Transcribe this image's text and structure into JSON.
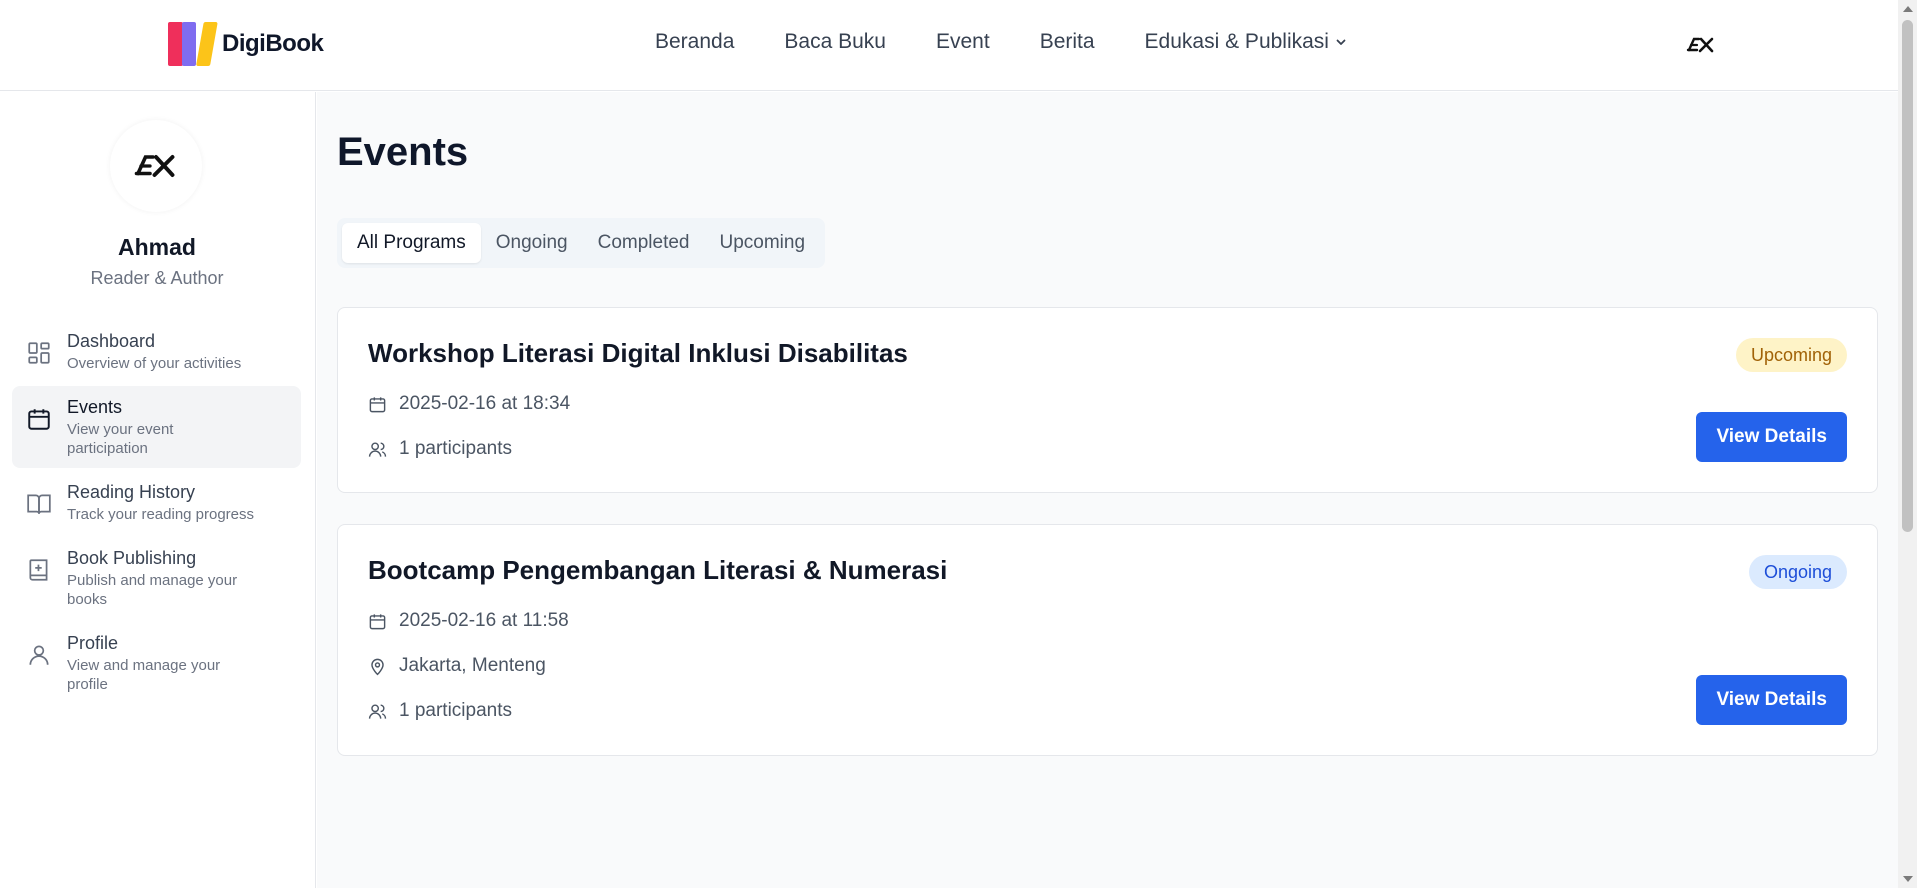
{
  "app": {
    "name": "DigiBook"
  },
  "nav": {
    "items": [
      {
        "label": "Beranda"
      },
      {
        "label": "Baca Buku"
      },
      {
        "label": "Event"
      },
      {
        "label": "Berita"
      },
      {
        "label": "Edukasi & Publikasi",
        "has_dropdown": true
      }
    ]
  },
  "user": {
    "name": "Ahmad",
    "role": "Reader & Author",
    "avatar_icon": "ex-logo-icon"
  },
  "sidebar": {
    "items": [
      {
        "title": "Dashboard",
        "desc": "Overview of your activities",
        "icon": "dashboard-icon"
      },
      {
        "title": "Events",
        "desc": "View your event participation",
        "icon": "calendar-icon",
        "active": true
      },
      {
        "title": "Reading History",
        "desc": "Track your reading progress",
        "icon": "book-open-icon"
      },
      {
        "title": "Book Publishing",
        "desc": "Publish and manage your books",
        "icon": "book-plus-icon"
      },
      {
        "title": "Profile",
        "desc": "View and manage your profile",
        "icon": "user-icon"
      }
    ]
  },
  "main": {
    "title": "Events",
    "tabs": [
      {
        "label": "All Programs",
        "active": true
      },
      {
        "label": "Ongoing"
      },
      {
        "label": "Completed"
      },
      {
        "label": "Upcoming"
      }
    ],
    "events": [
      {
        "title": "Workshop Literasi Digital Inklusi Disabilitas",
        "status": "Upcoming",
        "datetime": "2025-02-16 at 18:34",
        "participants": "1 participants",
        "button": "View Details"
      },
      {
        "title": "Bootcamp Pengembangan Literasi & Numerasi",
        "status": "Ongoing",
        "datetime": "2025-02-16 at 11:58",
        "location": "Jakarta, Menteng",
        "participants": "1 participants",
        "button": "View Details"
      }
    ]
  },
  "colors": {
    "primary": "#2563eb",
    "upcoming_bg": "#fef3c7",
    "upcoming_text": "#a16207",
    "ongoing_bg": "#dbeafe",
    "ongoing_text": "#1d4ed8",
    "logo_red": "#ef2f5b",
    "logo_purple": "#7f6cf0",
    "logo_yellow": "#fcc419"
  }
}
